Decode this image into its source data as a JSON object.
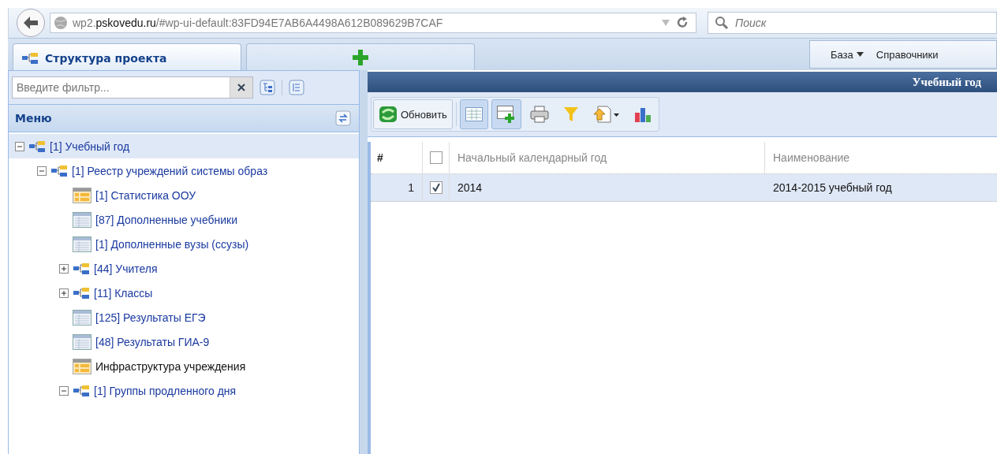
{
  "browser": {
    "address_host_prefix": "wp2.",
    "address_host": "pskovedu.ru",
    "address_path": "/#wp-ui-default:83FD94E7AB6A4498A612B089629B7CAF",
    "search_placeholder": "Поиск"
  },
  "tabs": [
    {
      "label": "Структура проекта",
      "selected": true,
      "kind": "tree"
    },
    {
      "selected": false,
      "kind": "add"
    }
  ],
  "top_menu": [
    {
      "label": "База",
      "dropdown": true
    },
    {
      "label": "Справочники",
      "dropdown": false
    }
  ],
  "sidebar": {
    "filter_placeholder": "Введите фильтр...",
    "menu_title": "Меню",
    "tree": [
      {
        "label": "[1] Учебный год",
        "kind": "folder",
        "expanded": true,
        "selected": true,
        "children": [
          {
            "label": "[1] Реестр учреждений системы образ",
            "kind": "folder",
            "expanded": true,
            "selected": false,
            "children": [
              {
                "label": "[1] Статистика ООУ",
                "kind": "report",
                "selected": false
              },
              {
                "label": "[87] Дополненные учебники",
                "kind": "table",
                "selected": false
              },
              {
                "label": "[1] Дополненные вузы (ссузы)",
                "kind": "table",
                "selected": false
              },
              {
                "label": "[44] Учителя",
                "kind": "folder",
                "expanded": false,
                "selected": false
              },
              {
                "label": "[11] Классы",
                "kind": "folder",
                "expanded": false,
                "selected": false
              },
              {
                "label": "[125] Результаты ЕГЭ",
                "kind": "table",
                "selected": false
              },
              {
                "label": "[48] Результаты ГИА-9",
                "kind": "table",
                "selected": false
              },
              {
                "label": "Инфраструктура учреждения",
                "kind": "report",
                "selected": false
              },
              {
                "label": "[1] Группы продленного дня",
                "kind": "folder",
                "expanded": true,
                "selected": false
              }
            ]
          }
        ]
      }
    ]
  },
  "panel": {
    "title": "Учебный год",
    "toolbar": [
      {
        "kind": "refresh",
        "label": "Обновить",
        "pressed": false
      },
      {
        "kind": "grid",
        "pressed": true
      },
      {
        "kind": "add",
        "pressed": true
      },
      {
        "kind": "print",
        "pressed": false
      },
      {
        "kind": "filter",
        "pressed": false
      },
      {
        "kind": "export",
        "pressed": false
      },
      {
        "kind": "chart",
        "pressed": false
      }
    ],
    "table": {
      "columns": [
        "#",
        "Начальный календарный год",
        "Наименование"
      ],
      "all_checked": false,
      "rows": [
        {
          "checked": true,
          "selected": true,
          "cells": [
            "1",
            "2014",
            "2014-2015 учебный год"
          ]
        }
      ]
    }
  }
}
